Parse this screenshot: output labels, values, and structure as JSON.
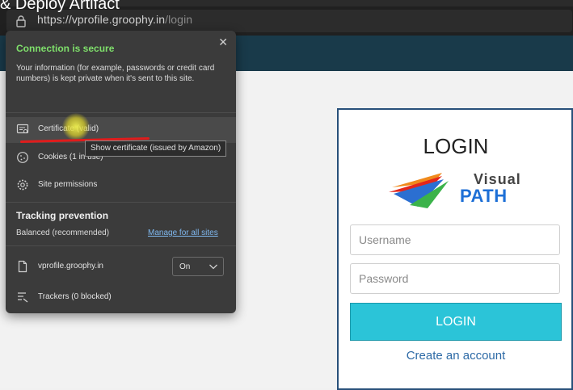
{
  "overlay": {
    "video_title": "& Deploy Artifact"
  },
  "browser": {
    "url_host": "https://vprofile.groophy.in",
    "url_path": "/login"
  },
  "popup": {
    "heading": "Connection is secure",
    "description": "Your information (for example, passwords or credit card numbers) is kept private when it's sent to this site.",
    "items": [
      {
        "label": "Certificate (valid)",
        "icon": "certificate-icon"
      },
      {
        "label": "Cookies (1 in use)",
        "icon": "cookie-icon"
      },
      {
        "label": "Site permissions",
        "icon": "gear-icon"
      }
    ],
    "tooltip": "Show certificate (issued by Amazon)",
    "tracking": {
      "title": "Tracking prevention",
      "level": "Balanced (recommended)",
      "manage_link": "Manage for all sites"
    },
    "site_row": {
      "domain": "vprofile.groophy.in",
      "toggle_value": "On"
    },
    "trackers_label": "Trackers (0 blocked)",
    "colors": {
      "secure_green": "#7fe06b",
      "link_blue": "#7fb8ef",
      "annotation_red": "#e01c1c"
    }
  },
  "login": {
    "title": "LOGIN",
    "logo": {
      "line1": "Visual",
      "line2": "PATH"
    },
    "username_placeholder": "Username",
    "password_placeholder": "Password",
    "button_label": "LOGIN",
    "create_account": "Create an account",
    "colors": {
      "button": "#2bc4d8",
      "border": "#28507a",
      "link": "#2d6aa6"
    }
  }
}
